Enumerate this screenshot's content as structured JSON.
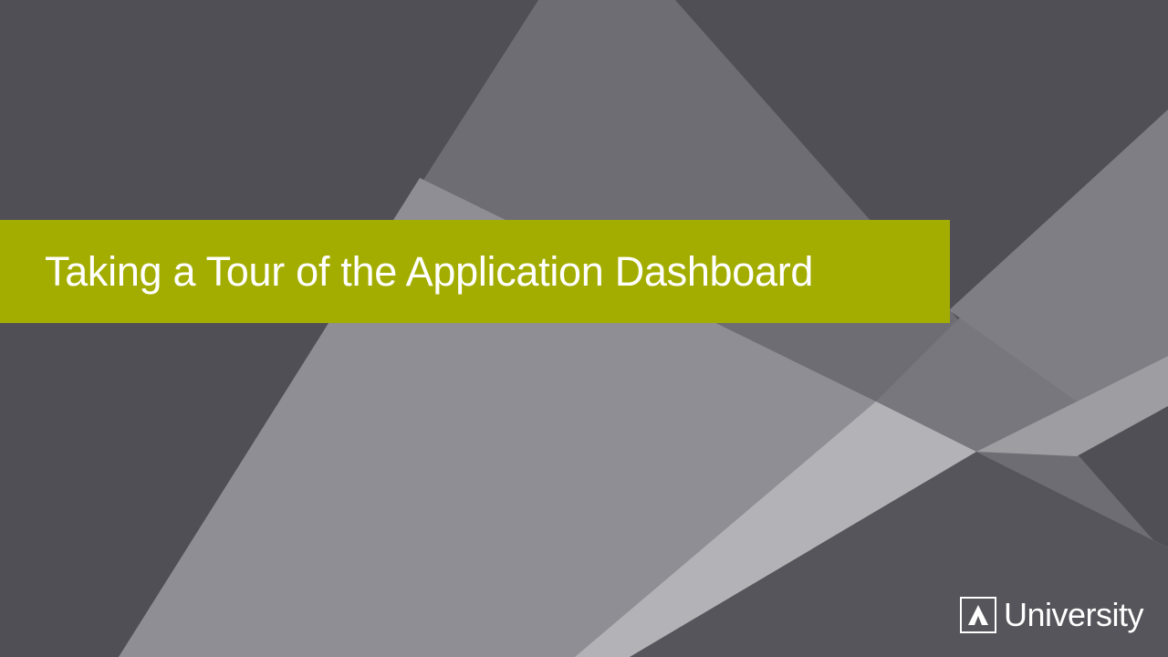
{
  "slide": {
    "title": "Taking a Tour of the Application Dashboard",
    "brand": {
      "icon": "a-logo-icon",
      "label": "University"
    }
  },
  "colors": {
    "background": "#4f4f55",
    "banner": "#a3ad00",
    "text": "#ffffff",
    "facet_light": "#b4b4b8",
    "facet_mid": "#8c8c92",
    "facet_dark": "#6c6c72"
  }
}
